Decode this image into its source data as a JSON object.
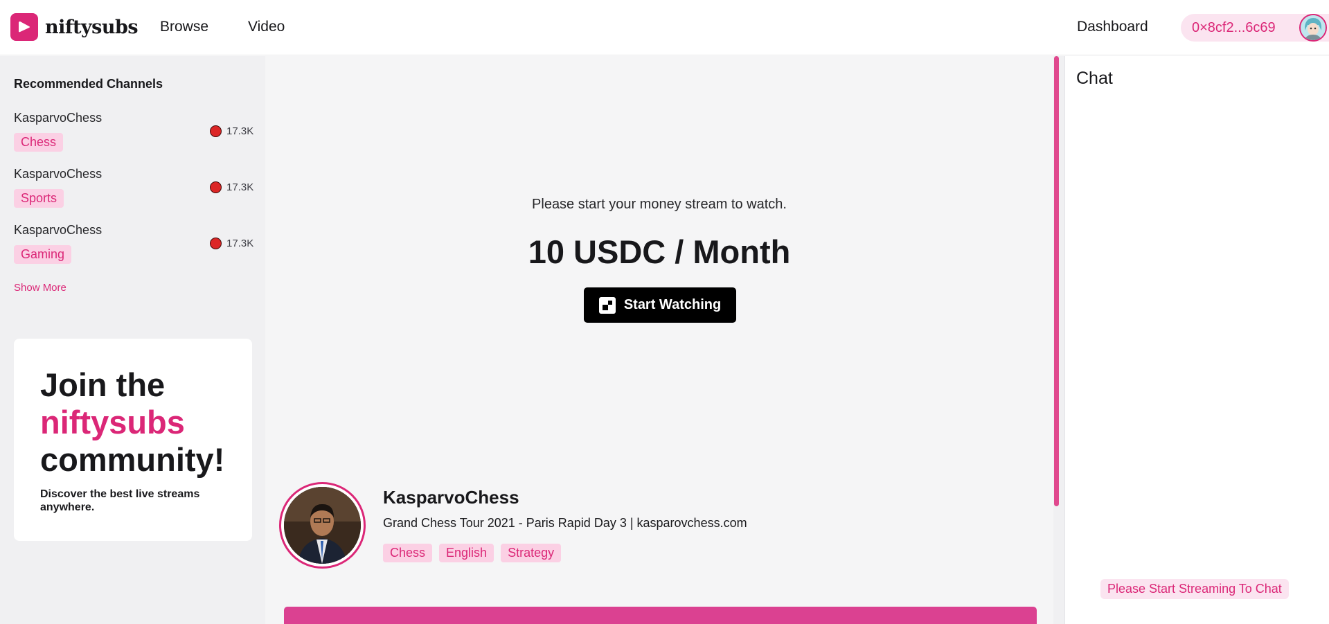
{
  "header": {
    "logo_text": "niftysubs",
    "nav": {
      "browse": "Browse",
      "video": "Video"
    },
    "dashboard": "Dashboard",
    "wallet_address": "0×8cf2...6c69"
  },
  "sidebar": {
    "title": "Recommended Channels",
    "channels": [
      {
        "name": "KasparvoChess",
        "tag": "Chess",
        "viewers": "17.3K"
      },
      {
        "name": "KasparvoChess",
        "tag": "Sports",
        "viewers": "17.3K"
      },
      {
        "name": "KasparvoChess",
        "tag": "Gaming",
        "viewers": "17.3K"
      }
    ],
    "show_more": "Show More",
    "join": {
      "line1": "Join the",
      "brand": "niftysubs",
      "line3": "community!",
      "subtitle": "Discover the best live streams anywhere."
    }
  },
  "player": {
    "prompt": "Please start your money stream to watch.",
    "price": "10 USDC / Month",
    "button": "Start Watching"
  },
  "stream": {
    "streamer": "KasparvoChess",
    "title": "Grand Chess Tour 2021 - Paris Rapid Day 3 | kasparovchess.com",
    "tags": [
      "Chess",
      "English",
      "Strategy"
    ]
  },
  "chat": {
    "title": "Chat",
    "notice": "Please Start Streaming To Chat"
  },
  "colors": {
    "accent": "#db2777",
    "tag_bg": "#fbd0e4",
    "live": "#dc2626"
  }
}
